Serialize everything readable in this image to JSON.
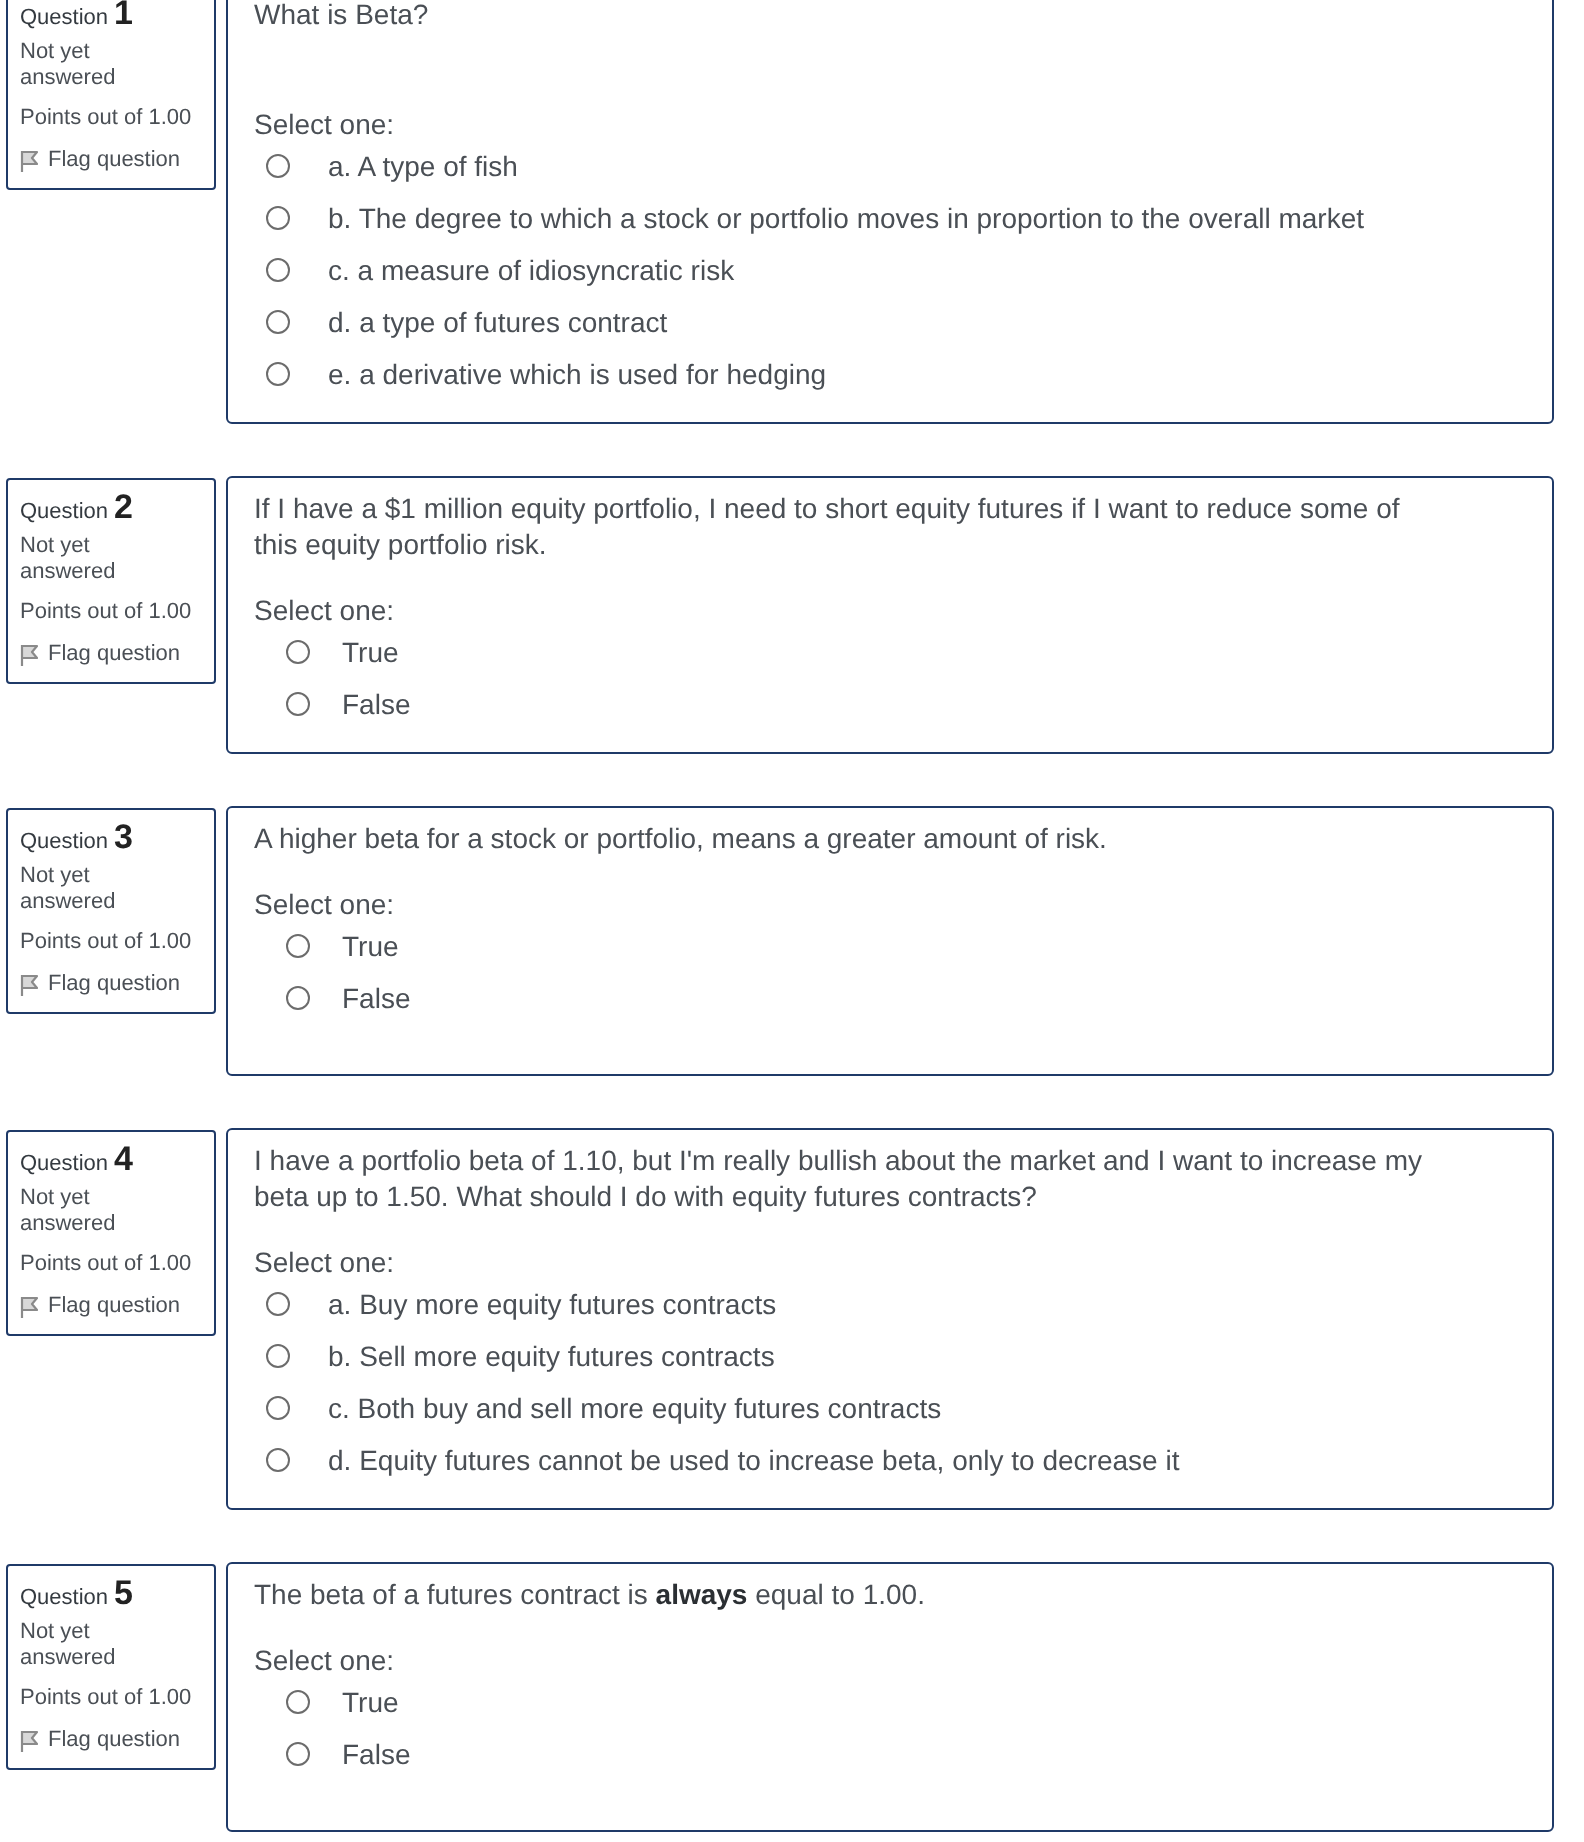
{
  "questions": [
    {
      "label": "Question",
      "number": "1",
      "status": "Not yet answered",
      "points": "Points out of 1.00",
      "flag_label": "Flag question",
      "kind": "multichoice",
      "text": "What is Beta?",
      "blank_line_after_text": true,
      "prompt": "Select one:",
      "options": [
        {
          "label": "a. A type of fish",
          "selected": false
        },
        {
          "label": "b. The degree to which a stock or portfolio moves in proportion to the overall market",
          "selected": false
        },
        {
          "label": "c. a measure of idiosyncratic risk",
          "selected": false
        },
        {
          "label": "d. a type of futures contract",
          "selected": false
        },
        {
          "label": "e. a derivative which is used for hedging",
          "selected": false
        }
      ]
    },
    {
      "label": "Question",
      "number": "2",
      "status": "Not yet answered",
      "points": "Points out of 1.00",
      "flag_label": "Flag question",
      "kind": "truefalse",
      "text": "If I have a $1 million equity portfolio, I need to short equity futures if I want to reduce some of this equity portfolio risk.",
      "blank_line_after_text": false,
      "prompt": "Select one:",
      "options": [
        {
          "label": "True",
          "selected": false
        },
        {
          "label": "False",
          "selected": false
        }
      ]
    },
    {
      "label": "Question",
      "number": "3",
      "status": "Not yet answered",
      "points": "Points out of 1.00",
      "flag_label": "Flag question",
      "kind": "truefalse",
      "text": "A higher beta for a stock or portfolio, means a greater amount of risk.",
      "blank_line_after_text": false,
      "prompt": "Select one:",
      "options": [
        {
          "label": "True",
          "selected": false
        },
        {
          "label": "False",
          "selected": false
        }
      ]
    },
    {
      "label": "Question",
      "number": "4",
      "status": "Not yet answered",
      "points": "Points out of 1.00",
      "flag_label": "Flag question",
      "kind": "multichoice",
      "text": "I have a portfolio beta of 1.10, but I'm really bullish about the market and I want to increase my beta up to 1.50. What should I do with equity futures contracts?",
      "blank_line_after_text": false,
      "prompt": "Select one:",
      "options": [
        {
          "label": "a. Buy more equity futures contracts",
          "selected": false
        },
        {
          "label": "b. Sell more equity futures contracts",
          "selected": false
        },
        {
          "label": "c. Both buy and sell more equity futures contracts",
          "selected": false
        },
        {
          "label": "d. Equity futures cannot be used to increase beta, only to decrease it",
          "selected": false
        }
      ]
    },
    {
      "label": "Question",
      "number": "5",
      "status": "Not yet answered",
      "points": "Points out of 1.00",
      "flag_label": "Flag question",
      "kind": "truefalse",
      "text": "The beta of a futures contract is **always** equal to 1.00.",
      "blank_line_after_text": false,
      "prompt": "Select one:",
      "options": [
        {
          "label": "True",
          "selected": false
        },
        {
          "label": "False",
          "selected": false
        }
      ]
    }
  ]
}
